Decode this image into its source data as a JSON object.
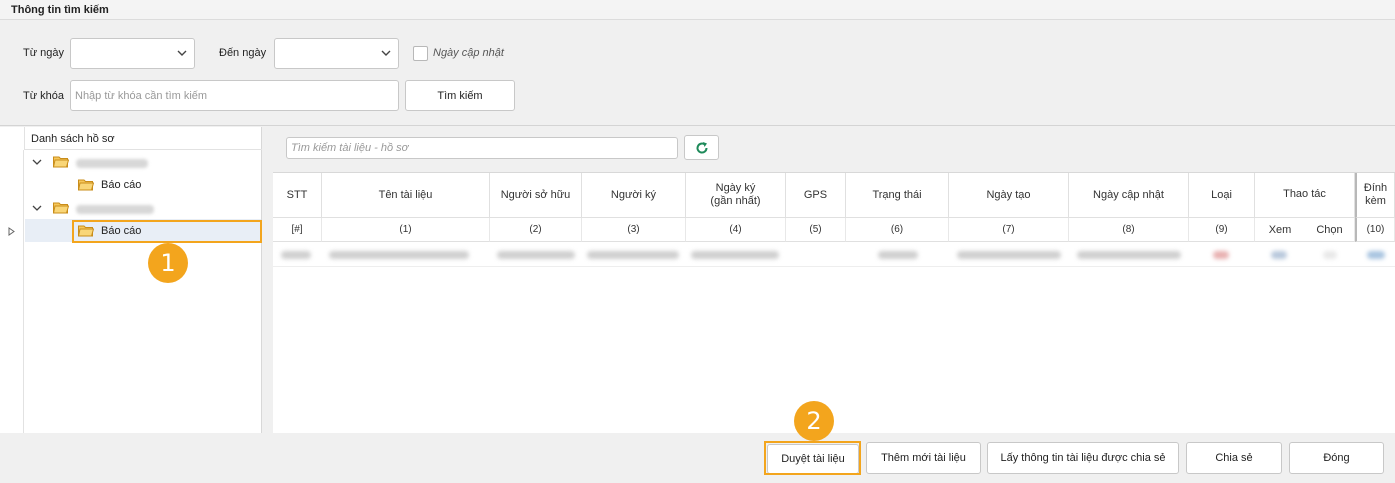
{
  "search": {
    "title": "Thông tin tìm kiếm",
    "from_date_label": "Từ ngày",
    "to_date_label": "Đến ngày",
    "updated_date_label": "Ngày cập nhật",
    "keyword_label": "Từ khóa",
    "keyword_placeholder": "Nhập từ khóa cần tìm kiếm",
    "search_button": "Tìm kiếm"
  },
  "tree": {
    "header": "Danh sách hồ sơ",
    "items": [
      {
        "label": "Báo cáo"
      },
      {
        "label": "Báo cáo"
      }
    ]
  },
  "grid": {
    "search_placeholder": "Tìm kiếm tài liệu - hồ sơ",
    "columns": [
      {
        "title": "STT",
        "number": "[#]"
      },
      {
        "title": "Tên tài liệu",
        "number": "(1)"
      },
      {
        "title": "Người sở hữu",
        "number": "(2)"
      },
      {
        "title": "Người ký",
        "number": "(3)"
      },
      {
        "title": "Ngày ký\n(gần nhất)",
        "number": "(4)"
      },
      {
        "title": "GPS",
        "number": "(5)"
      },
      {
        "title": "Trạng thái",
        "number": "(6)"
      },
      {
        "title": "Ngày tạo",
        "number": "(7)"
      },
      {
        "title": "Ngày cập nhật",
        "number": "(8)"
      },
      {
        "title": "Loại",
        "number": "(9)"
      },
      {
        "title": "Thao tác",
        "sub": [
          "Xem",
          "Chọn"
        ]
      },
      {
        "title": "Đính\nkèm",
        "number": "(10)"
      }
    ]
  },
  "badges": {
    "one": "1",
    "two": "2"
  },
  "actions": {
    "approve": "Duyệt tài liệu",
    "add_new": "Thêm mới tài liệu",
    "get_shared": "Lấy thông tin tài liệu được chia sẻ",
    "share": "Chia sẻ",
    "close": "Đóng"
  },
  "colors": {
    "highlight": "#f3a51d",
    "refresh": "#1e8a5a",
    "folder": "#f0b23a"
  }
}
